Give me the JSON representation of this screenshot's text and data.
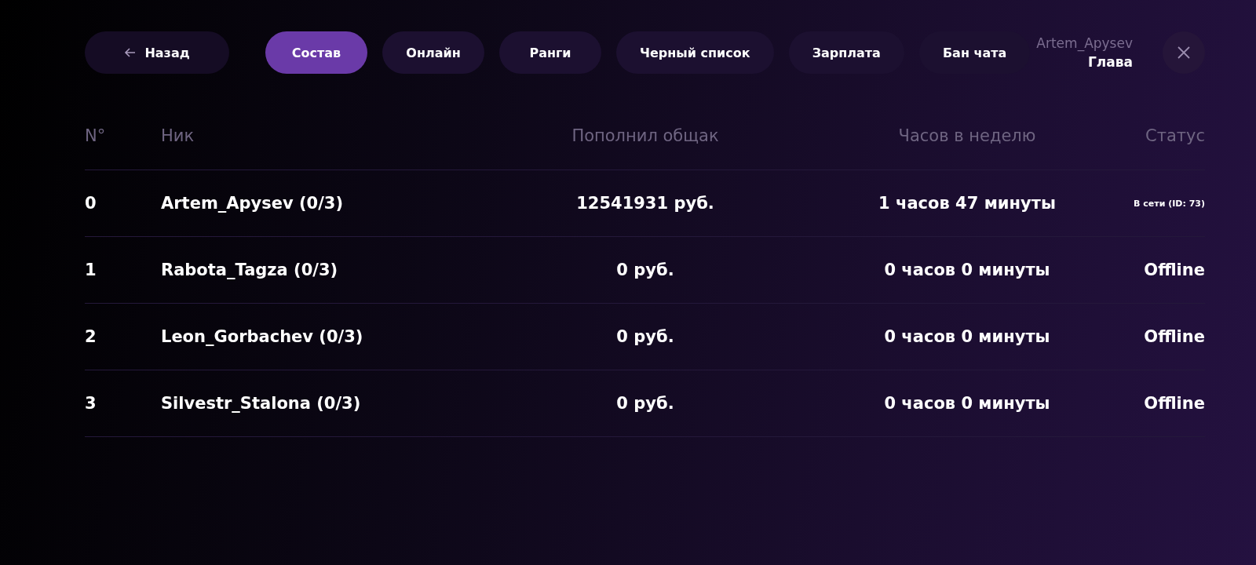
{
  "back_button": {
    "label": "Назад"
  },
  "tabs": [
    {
      "label": "Состав",
      "selected": true
    },
    {
      "label": "Онлайн",
      "selected": false
    },
    {
      "label": "Ранги",
      "selected": false
    },
    {
      "label": "Черный список",
      "selected": false
    },
    {
      "label": "Зарплата",
      "selected": false
    },
    {
      "label": "Бан чата",
      "selected": false
    }
  ],
  "user": {
    "name": "Artem_Apysev",
    "rank": "Глава"
  },
  "table": {
    "columns": [
      "N°",
      "Ник",
      "Пополнил общак",
      "Часов в неделю",
      "Статус"
    ],
    "rows": [
      {
        "number": "0",
        "nick": "Artem_Apysev (0/3)",
        "deposit": "12541931 руб.",
        "hours": "1 часов 47 минуты",
        "status": "В сети (ID: 73)",
        "online": true
      },
      {
        "number": "1",
        "nick": "Rabota_Tagza (0/3)",
        "deposit": "0 руб.",
        "hours": "0 часов 0 минуты",
        "status": "Offline",
        "online": false
      },
      {
        "number": "2",
        "nick": "Leon_Gorbachev (0/3)",
        "deposit": "0 руб.",
        "hours": "0 часов 0 минуты",
        "status": "Offline",
        "online": false
      },
      {
        "number": "3",
        "nick": "Silvestr_Stalona (0/3)",
        "deposit": "0 руб.",
        "hours": "0 часов 0 минуты",
        "status": "Offline",
        "online": false
      }
    ]
  }
}
